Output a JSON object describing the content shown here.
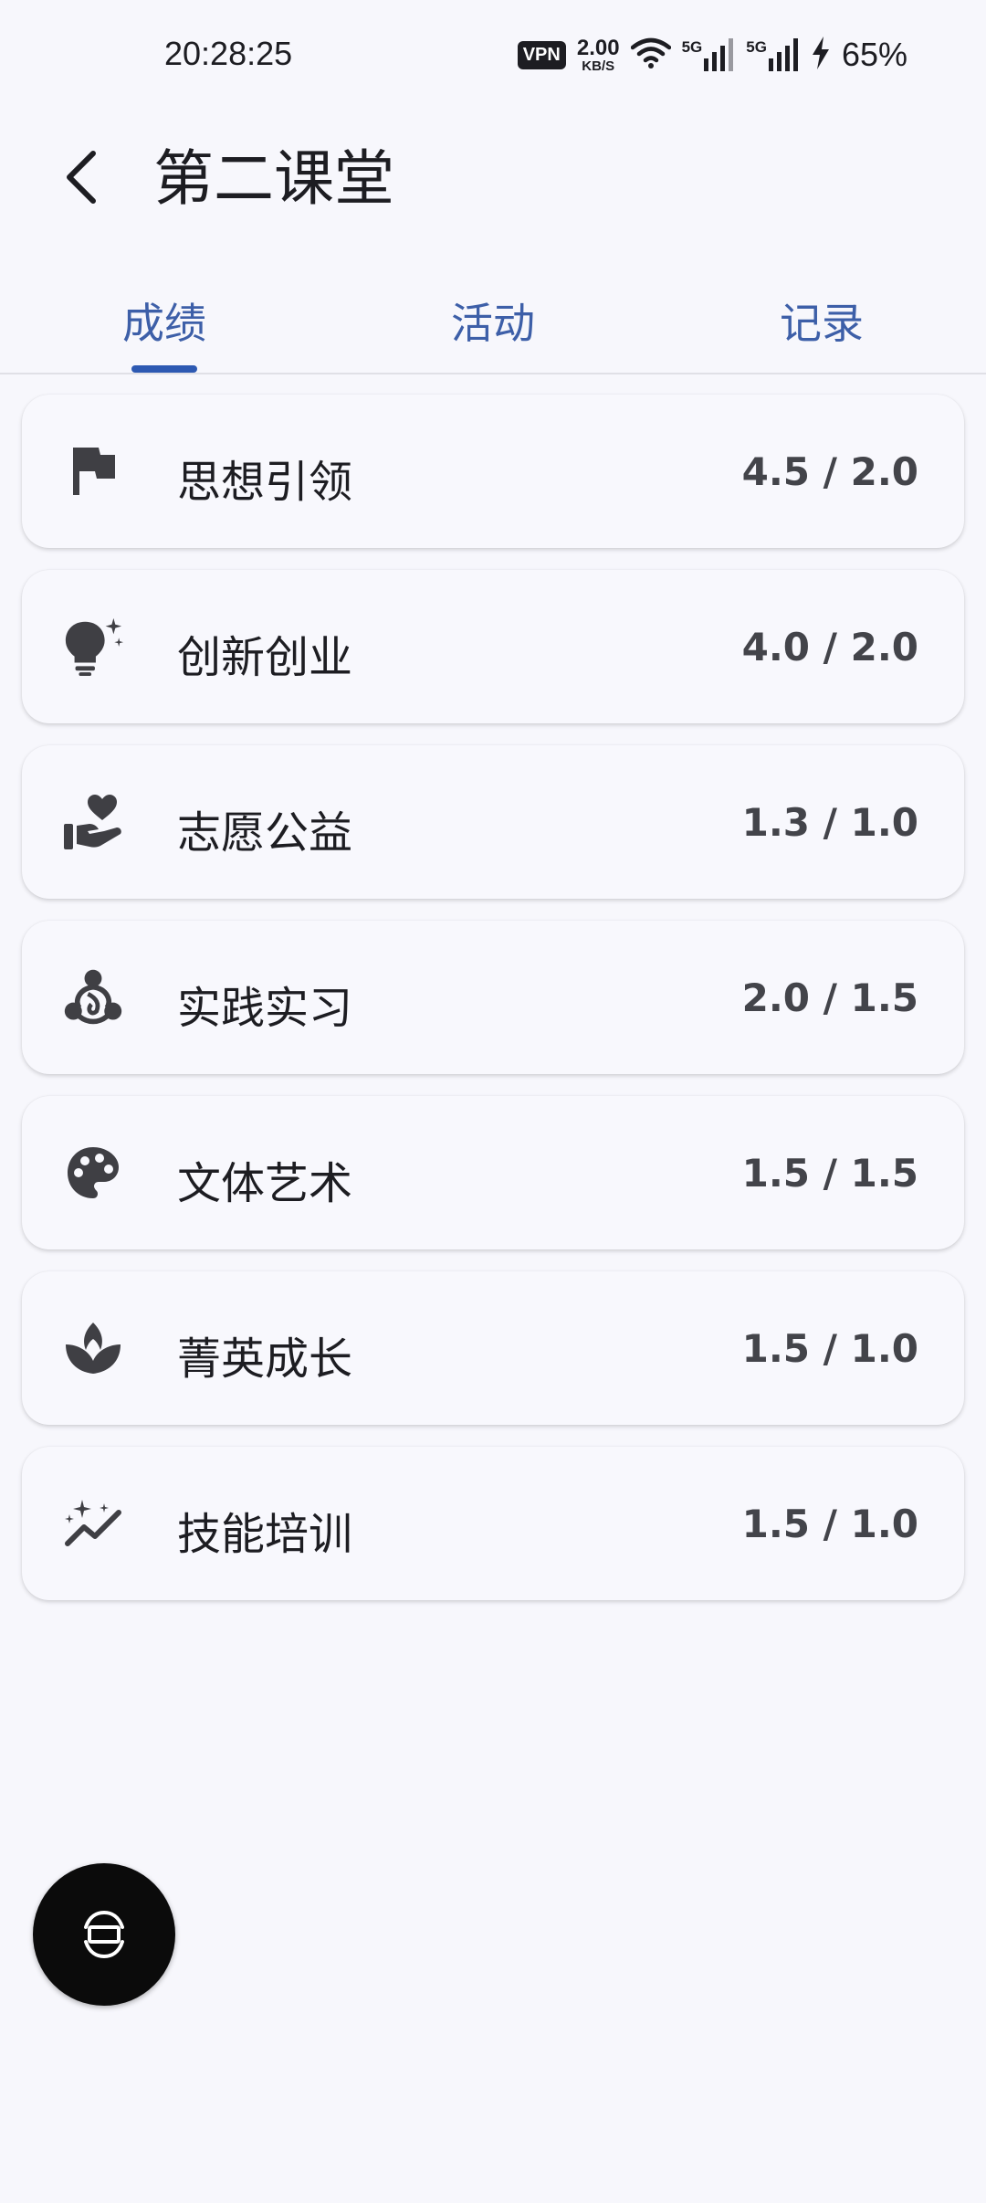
{
  "status_bar": {
    "time": "20:28:25",
    "vpn": "VPN",
    "speed_value": "2.00",
    "speed_unit": "KB/S",
    "network1": "5G",
    "network2": "5G",
    "battery": "65%"
  },
  "header": {
    "title": "第二课堂"
  },
  "tabs": [
    {
      "label": "成绩",
      "active": true
    },
    {
      "label": "活动",
      "active": false
    },
    {
      "label": "记录",
      "active": false
    }
  ],
  "categories": [
    {
      "icon": "flag-icon",
      "name": "思想引领",
      "score": "4.5 / 2.0"
    },
    {
      "icon": "lightbulb-icon",
      "name": "创新创业",
      "score": "4.0 / 2.0"
    },
    {
      "icon": "volunteer-heart-icon",
      "name": "志愿公益",
      "score": "1.3 / 1.0"
    },
    {
      "icon": "workspaces-icon",
      "name": "实践实习",
      "score": "2.0 / 1.5"
    },
    {
      "icon": "palette-icon",
      "name": "文体艺术",
      "score": "1.5 / 1.5"
    },
    {
      "icon": "spa-icon",
      "name": "菁英成长",
      "score": "1.5 / 1.0"
    },
    {
      "icon": "sparkle-trend-icon",
      "name": "技能培训",
      "score": "1.5 / 1.0"
    }
  ],
  "colors": {
    "accent": "#2D59B2",
    "tab_text": "#3D5FA8",
    "background": "#F7F7FC",
    "icon": "#3F3F44"
  }
}
